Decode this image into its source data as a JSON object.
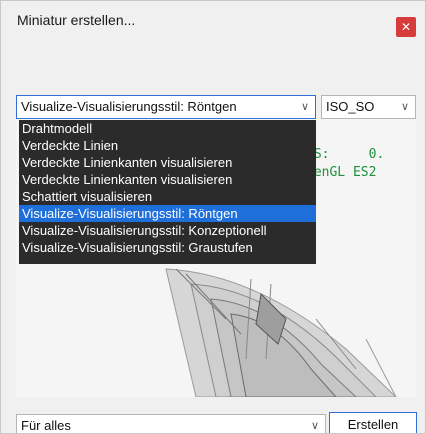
{
  "dialog": {
    "title": "Miniatur erstellen...",
    "close_icon": "close-icon"
  },
  "style_select": {
    "value": "Visualize-Visualisierungsstil: Röntgen",
    "chevron": "chevron-down-icon"
  },
  "view_select": {
    "value": "ISO_SO",
    "chevron": "chevron-down-icon"
  },
  "dropdown": {
    "options": [
      "Drahtmodell",
      "Verdeckte Linien",
      "Verdeckte Linienkanten visualisieren",
      "Verdeckte Linienkanten visualisieren",
      "Schattiert visualisieren",
      "Visualize-Visualisierungsstil: Röntgen",
      "Visualize-Visualisierungsstil: Konzeptionell",
      "Visualize-Visualisierungsstil: Graustufen"
    ],
    "selected_index": 5
  },
  "viewport_overlay": {
    "line1": "PS:     0.",
    "line2": "penGL ES2"
  },
  "scope_select": {
    "value": "Für alles",
    "chevron": "chevron-down-icon"
  },
  "buttons": {
    "create_label": "Erstellen"
  },
  "colors": {
    "accent": "#1e6fd9",
    "close": "#d63c3c",
    "overlay_text": "#1f8f3a",
    "dropdown_bg": "#2b2b2b"
  }
}
